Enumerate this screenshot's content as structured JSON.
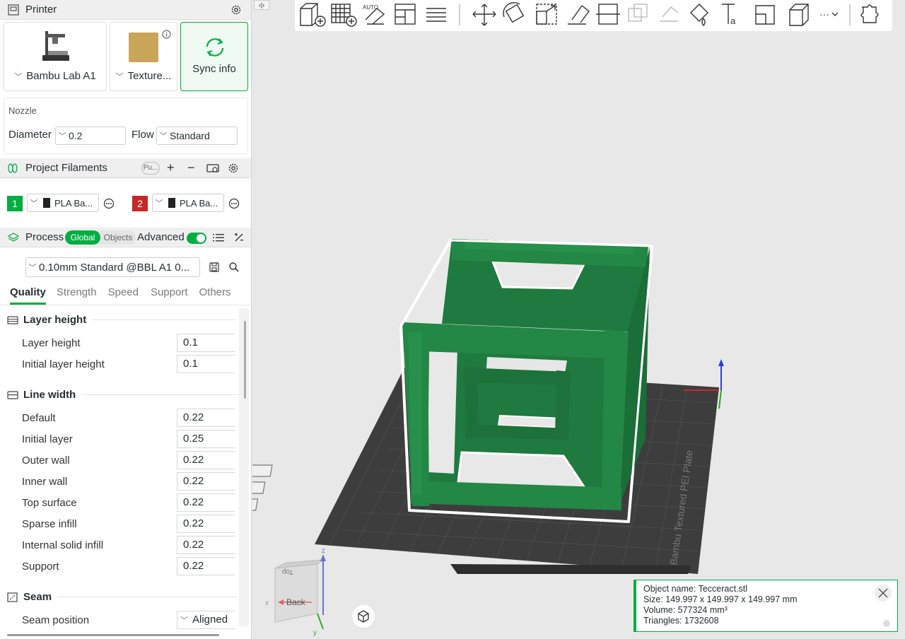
{
  "printer": {
    "title": "Printer",
    "printer_name": "Bambu Lab A1",
    "plate_name": "Texture...",
    "sync_label": "Sync info"
  },
  "nozzle": {
    "title": "Nozzle",
    "diameter_label": "Diameter",
    "diameter_value": "0.2",
    "flow_label": "Flow",
    "flow_value": "Standard"
  },
  "filaments": {
    "title": "Project Filaments",
    "pill": "Pu...",
    "items": [
      {
        "num": "1",
        "name": "PLA Ba...",
        "color": "#00ae42"
      },
      {
        "num": "2",
        "name": "PLA Ba...",
        "color": "#c62828"
      }
    ]
  },
  "process": {
    "title": "Process",
    "toggle_global": "Global",
    "toggle_objects": "Objects",
    "advanced_label": "Advanced",
    "preset": "0.10mm Standard @BBL A1 0...",
    "tabs": [
      "Quality",
      "Strength",
      "Speed",
      "Support",
      "Others"
    ]
  },
  "quality": {
    "layer_height_group": "Layer height",
    "layer_height_label": "Layer height",
    "layer_height_value": "0.1",
    "initial_layer_height_label": "Initial layer height",
    "initial_layer_height_value": "0.1",
    "line_width_group": "Line width",
    "line_width": [
      {
        "label": "Default",
        "value": "0.22"
      },
      {
        "label": "Initial layer",
        "value": "0.25"
      },
      {
        "label": "Outer wall",
        "value": "0.22"
      },
      {
        "label": "Inner wall",
        "value": "0.22"
      },
      {
        "label": "Top surface",
        "value": "0.22"
      },
      {
        "label": "Sparse infill",
        "value": "0.22"
      },
      {
        "label": "Internal solid infill",
        "value": "0.22"
      },
      {
        "label": "Support",
        "value": "0.22"
      }
    ],
    "seam_group": "Seam",
    "seam_position_label": "Seam position",
    "seam_position_value": "Aligned"
  },
  "viewport": {
    "plate_label": "Bambu Textured PEI Plate",
    "nav_cube_label": "Back",
    "nav_cube_top": "Top",
    "axis_x": "x",
    "axis_y": "y",
    "axis_z": "z"
  },
  "object_info": {
    "name_line": "Object name: Tecceract.stl",
    "size_line": "Size: 149.997 x 149.997 x 149.997 mm",
    "volume_line": "Volume: 577324 mm³",
    "triangles_line": "Triangles: 1732608"
  },
  "colors": {
    "accent": "#00ae42",
    "model": "#1e7a3e",
    "filament2": "#c62828"
  }
}
